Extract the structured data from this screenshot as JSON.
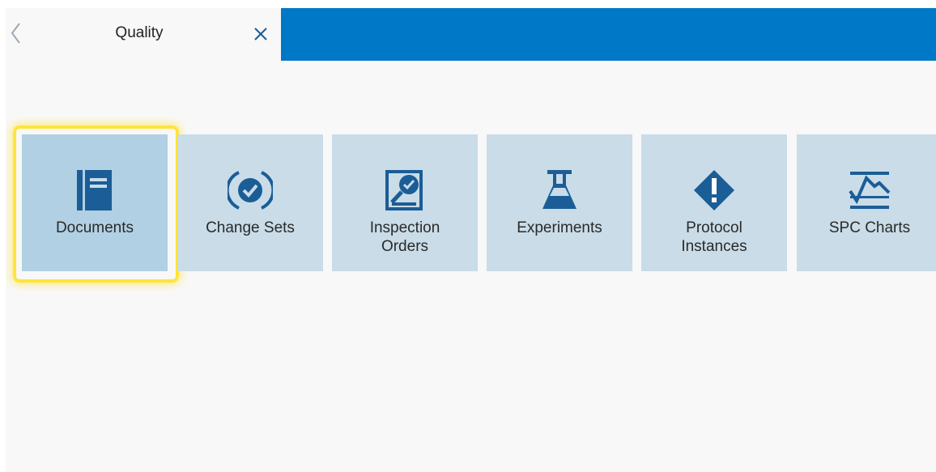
{
  "tab": {
    "title": "Quality",
    "back_icon": "chevron-left-icon",
    "close_icon": "close-icon"
  },
  "colors": {
    "accent_bar": "#0078c8",
    "tile_bg": "#c9dce8",
    "tile_selected_bg": "#b1d0e3",
    "icon": "#1b5d96",
    "focus_ring": "#ffe43c"
  },
  "tiles": [
    {
      "label": "Documents",
      "icon": "document-icon",
      "selected": true
    },
    {
      "label": "Change Sets",
      "icon": "checkmark-circle-icon",
      "selected": false
    },
    {
      "label": "Inspection\nOrders",
      "icon": "inspection-icon",
      "selected": false
    },
    {
      "label": "Experiments",
      "icon": "flask-icon",
      "selected": false
    },
    {
      "label": "Protocol\nInstances",
      "icon": "warning-diamond-icon",
      "selected": false
    },
    {
      "label": "SPC Charts",
      "icon": "spc-chart-icon",
      "selected": false
    }
  ]
}
